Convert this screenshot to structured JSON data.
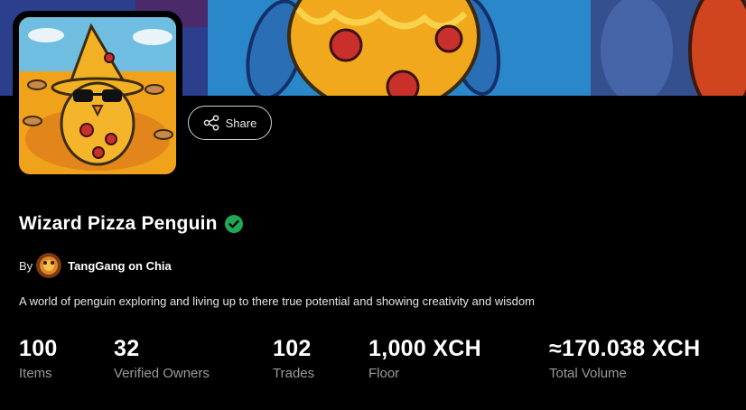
{
  "collection": {
    "title": "Wizard Pizza Penguin",
    "verified": true,
    "by_label": "By",
    "creator_name": "TangGang on Chia",
    "description": "A world of penguin exploring and living up to there true potential and showing creativity and wisdom"
  },
  "actions": {
    "share_label": "Share"
  },
  "stats": [
    {
      "value": "100",
      "label": "Items"
    },
    {
      "value": "32",
      "label": "Verified Owners"
    },
    {
      "value": "102",
      "label": "Trades"
    },
    {
      "value": "1,000 XCH",
      "label": "Floor"
    },
    {
      "value": "≈170.038 XCH",
      "label": "Total Volume"
    }
  ],
  "colors": {
    "background": "#000000",
    "verified": "#1fa855",
    "muted_text": "#9a9a9a",
    "banner_sky": "#2a87c9",
    "pizza": "#f2a81c"
  },
  "icons": {
    "share": "share-icon",
    "verified": "verified-check-icon"
  }
}
